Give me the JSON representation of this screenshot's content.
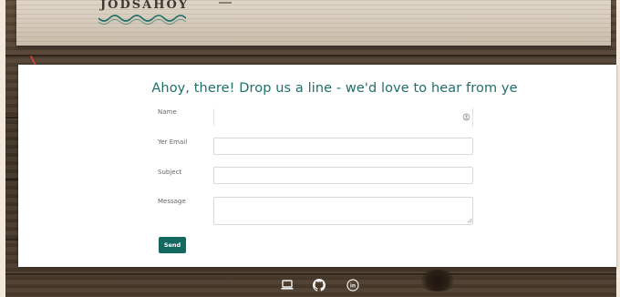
{
  "header": {
    "logo_text": "JODSAHOY"
  },
  "contact": {
    "title": "Ahoy, there! Drop us a line - we'd love to hear from ye",
    "fields": {
      "name_label": "Name",
      "name_value": "",
      "email_label": "Yer Email",
      "email_value": "",
      "subject_label": "Subject",
      "subject_value": "",
      "message_label": "Message",
      "message_value": ""
    },
    "send_label": "Send"
  },
  "footer": {
    "icons": [
      "laptop-icon",
      "github-icon",
      "linkedin-icon"
    ],
    "linkedin_glyph": "in"
  },
  "colors": {
    "accent": "#1f6f6a",
    "button": "#13685f",
    "annotation": "#e0403a"
  }
}
